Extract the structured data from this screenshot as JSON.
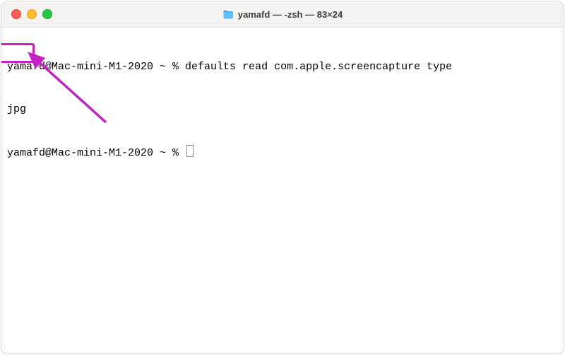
{
  "window": {
    "title": "yamafd — -zsh — 83×24"
  },
  "terminal": {
    "prompt": "yamafd@Mac-mini-M1-2020 ~ % ",
    "command": "defaults read com.apple.screencapture type",
    "output": "jpg"
  },
  "annotation": {
    "highlight_target": "jpg",
    "color_hex": "#C223C2"
  }
}
